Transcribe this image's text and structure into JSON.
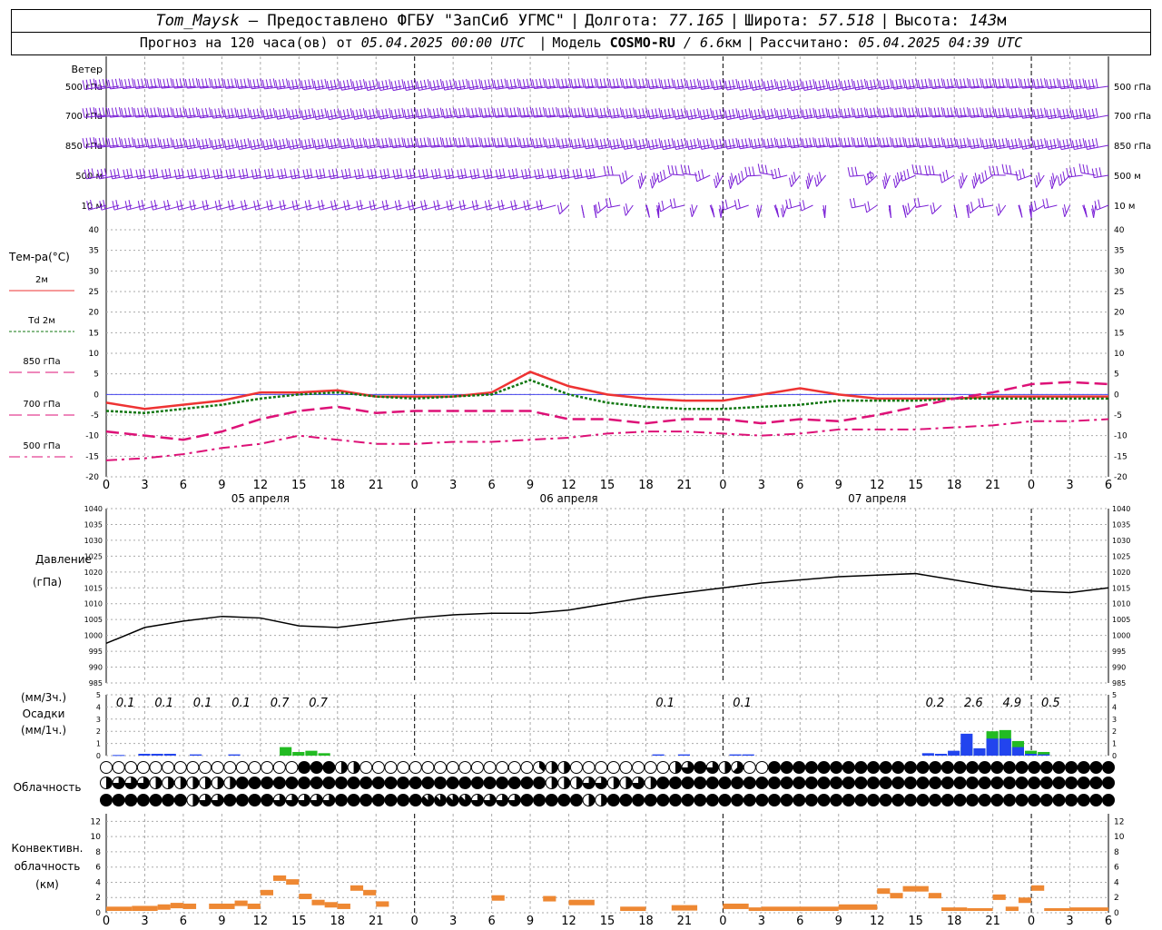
{
  "header": {
    "station": "Tom_Maysk",
    "dash": "–",
    "provider": "Предоставлено ФГБУ \"ЗапСиб УГМС\"",
    "lon_label": "Долгота:",
    "lon_value": "77.165",
    "lat_label": "Широта:",
    "lat_value": "57.518",
    "alt_label": "Высота:",
    "alt_value": "143",
    "alt_unit": "м",
    "forecast_prefix": "Прогноз на 120 часа(ов) от",
    "forecast_date": "05.04.2025 00:00 UTC",
    "model_label": "Модель",
    "model_name": "COSMO-RU",
    "model_res": "/ 6.6",
    "model_res_unit": "км",
    "computed_label": "Рассчитано:",
    "computed_date": "05.04.2025 04:39 UTC"
  },
  "colors": {
    "wind": "#7a1fd6",
    "t2m": "#ee3333",
    "td2m": "#117711",
    "levels": "#dd1177",
    "pressure": "#000000",
    "precip3h": "#22bb22",
    "precip1h": "#2244ee",
    "convective": "#ee8833",
    "grid": "#aaaaaa"
  },
  "labels": {
    "wind_title": "Ветер",
    "wind_levels": [
      "500 гПа",
      "700 гПа",
      "850 гПа",
      "500 м",
      "10 м"
    ],
    "temp_title": "Тем-ра(°С)",
    "temp_legend": [
      "2м",
      "Td  2м",
      "850 гПа",
      "700 гПа",
      "500 гПа"
    ],
    "pressure_title": "Давление",
    "pressure_unit": "(гПа)",
    "precip_title_1": "(мм/3ч.)",
    "precip_title_2": "Осадки",
    "precip_title_3": "(мм/1ч.)",
    "cloud_title": "Облачность",
    "conv_title_1": "Конвективн.",
    "conv_title_2": "облачность",
    "conv_title_3": "(км)"
  },
  "chart_data": [
    {
      "type": "wind_barbs",
      "levels": [
        "500 гПа",
        "700 гПа",
        "850 гПа",
        "500 м",
        "10 м"
      ]
    },
    {
      "type": "line",
      "title": "Тем-ра(°С)",
      "ylim": [
        -20,
        40
      ],
      "yticks": [
        -20,
        -15,
        -10,
        -5,
        0,
        5,
        10,
        15,
        20,
        25,
        30,
        35,
        40
      ],
      "x_hours": [
        0,
        3,
        6,
        9,
        12,
        15,
        18,
        21,
        24,
        27,
        30,
        33,
        36,
        39,
        42,
        45,
        48,
        51,
        54,
        57,
        60,
        63,
        66,
        69,
        72,
        75,
        78
      ],
      "series": [
        {
          "name": "2м",
          "style": "solid",
          "values": [
            -2,
            -3.5,
            -2.5,
            -1.5,
            0.5,
            0.5,
            1,
            -0.5,
            -0.5,
            -0.5,
            0.5,
            5.5,
            2,
            0,
            -1,
            -1.5,
            -1.5,
            0,
            1.5,
            0,
            -1,
            -1,
            -1,
            -0.5,
            -0.5,
            -0.5,
            -0.5
          ]
        },
        {
          "name": "Td  2м",
          "style": "dotted",
          "values": [
            -4,
            -4.5,
            -3.5,
            -2.5,
            -1,
            0,
            0.5,
            -0.5,
            -1,
            -0.5,
            0,
            3.5,
            0,
            -2,
            -3,
            -3.5,
            -3.5,
            -3,
            -2.5,
            -1.5,
            -1.5,
            -1.5,
            -1,
            -1,
            -1,
            -1,
            -1
          ]
        },
        {
          "name": "850 гПа",
          "style": "dashed",
          "values": [
            -9,
            -10,
            -11,
            -9,
            -6,
            -4,
            -3,
            -4.5,
            -4,
            -4,
            -4,
            -4,
            -6,
            -6,
            -7,
            -6,
            -6,
            -7,
            -6,
            -6.5,
            -5,
            -3,
            -1,
            0.5,
            2.5,
            3,
            2.5
          ]
        },
        {
          "name": "700 гПа",
          "style": "dashdot",
          "values": [
            -16,
            -15.5,
            -14.5,
            -13,
            -12,
            -10,
            -11,
            -12,
            -12,
            -11.5,
            -11.5,
            -11,
            -10.5,
            -9.5,
            -9,
            -9,
            -9.5,
            -10,
            -9.5,
            -8.5,
            -8.5,
            -8.5,
            -8,
            -7.5,
            -6.5,
            -6.5,
            -6
          ]
        }
      ]
    },
    {
      "type": "line",
      "title": "Давление",
      "ylabel": "(гПа)",
      "ylim": [
        985,
        1040
      ],
      "yticks": [
        985,
        990,
        995,
        1000,
        1005,
        1010,
        1015,
        1020,
        1025,
        1030,
        1035,
        1040
      ],
      "x_hours": [
        0,
        3,
        6,
        9,
        12,
        15,
        18,
        21,
        24,
        27,
        30,
        33,
        36,
        39,
        42,
        45,
        48,
        51,
        54,
        57,
        60,
        63,
        66,
        69,
        72,
        75,
        78
      ],
      "series": [
        {
          "name": "",
          "values": [
            997.5,
            1002.5,
            1004.5,
            1006,
            1005.5,
            1003,
            1002.5,
            1004,
            1005.5,
            1006.5,
            1007,
            1007,
            1008,
            1010,
            1012,
            1013.5,
            1015,
            1016.5,
            1017.5,
            1018.5,
            1019,
            1019.5,
            1017.5,
            1015.5,
            1014,
            1013.5,
            1015
          ]
        }
      ]
    },
    {
      "type": "bar",
      "title": "Осадки",
      "ylim": [
        0,
        5
      ],
      "yticks": [
        0,
        1,
        2,
        3,
        4,
        5
      ],
      "annotations_3h": [
        {
          "hour": 1.5,
          "text": "0.1"
        },
        {
          "hour": 4.5,
          "text": "0.1"
        },
        {
          "hour": 7.5,
          "text": "0.1"
        },
        {
          "hour": 10.5,
          "text": "0.1"
        },
        {
          "hour": 13.5,
          "text": "0.7"
        },
        {
          "hour": 16.5,
          "text": "0.7"
        },
        {
          "hour": 43.5,
          "text": "0.1"
        },
        {
          "hour": 49.5,
          "text": "0.1"
        },
        {
          "hour": 64.5,
          "text": "0.2"
        },
        {
          "hour": 67.5,
          "text": "2.6"
        },
        {
          "hour": 70.5,
          "text": "4.9"
        },
        {
          "hour": 73.5,
          "text": "0.5"
        }
      ],
      "bars_1h_green": [
        {
          "hour": 14,
          "value": 0.7
        },
        {
          "hour": 15,
          "value": 0.3
        },
        {
          "hour": 16,
          "value": 0.4
        },
        {
          "hour": 17,
          "value": 0.2
        },
        {
          "hour": 67,
          "value": 0.7
        },
        {
          "hour": 69,
          "value": 2.0
        },
        {
          "hour": 70,
          "value": 2.1
        },
        {
          "hour": 71,
          "value": 1.2
        },
        {
          "hour": 72,
          "value": 0.4
        },
        {
          "hour": 73,
          "value": 0.3
        }
      ],
      "bars_1h_blue": [
        {
          "hour": 1,
          "value": 0.05
        },
        {
          "hour": 3,
          "value": 0.15
        },
        {
          "hour": 4,
          "value": 0.15
        },
        {
          "hour": 5,
          "value": 0.15
        },
        {
          "hour": 7,
          "value": 0.1
        },
        {
          "hour": 10,
          "value": 0.1
        },
        {
          "hour": 43,
          "value": 0.1
        },
        {
          "hour": 45,
          "value": 0.1
        },
        {
          "hour": 49,
          "value": 0.1
        },
        {
          "hour": 50,
          "value": 0.1
        },
        {
          "hour": 64,
          "value": 0.2
        },
        {
          "hour": 65,
          "value": 0.15
        },
        {
          "hour": 66,
          "value": 0.4
        },
        {
          "hour": 67,
          "value": 1.8
        },
        {
          "hour": 68,
          "value": 0.6
        },
        {
          "hour": 69,
          "value": 1.4
        },
        {
          "hour": 70,
          "value": 1.4
        },
        {
          "hour": 71,
          "value": 0.7
        },
        {
          "hour": 72,
          "value": 0.15
        },
        {
          "hour": 73,
          "value": 0.1
        }
      ]
    },
    {
      "type": "cloud_cover",
      "title": "Облачность",
      "rows": [
        "0000000000000000888440000000000000034400000000468645008888888888888888888888888888",
        "4666444444488888888888888888888888884446644648888888888888888888888888888888888888",
        "8888888466888866666888888877776666888884488888888888888888888888888888888888888888"
      ]
    },
    {
      "type": "bar",
      "title": "Конвективн. облачность (км)",
      "ylim": [
        0,
        13
      ],
      "yticks": [
        0,
        2,
        4,
        6,
        8,
        10,
        12
      ],
      "segments": [
        {
          "start": 0,
          "end": 2,
          "value": 0.8
        },
        {
          "start": 2,
          "end": 4,
          "value": 0.9
        },
        {
          "start": 4,
          "end": 5,
          "value": 1.1
        },
        {
          "start": 5,
          "end": 6,
          "value": 1.3
        },
        {
          "start": 6,
          "end": 7,
          "value": 1.2
        },
        {
          "start": 8,
          "end": 10,
          "value": 1.2
        },
        {
          "start": 10,
          "end": 11,
          "value": 1.6
        },
        {
          "start": 11,
          "end": 12,
          "value": 1.2
        },
        {
          "start": 12,
          "end": 13,
          "value": 3.0
        },
        {
          "start": 13,
          "end": 14,
          "value": 4.9
        },
        {
          "start": 14,
          "end": 15,
          "value": 4.4
        },
        {
          "start": 15,
          "end": 16,
          "value": 2.5
        },
        {
          "start": 16,
          "end": 17,
          "value": 1.7
        },
        {
          "start": 17,
          "end": 18,
          "value": 1.4
        },
        {
          "start": 18,
          "end": 19,
          "value": 1.2
        },
        {
          "start": 19,
          "end": 20,
          "value": 3.6
        },
        {
          "start": 20,
          "end": 21,
          "value": 3.0
        },
        {
          "start": 21,
          "end": 22,
          "value": 1.5
        },
        {
          "start": 30,
          "end": 31,
          "value": 2.3
        },
        {
          "start": 34,
          "end": 35,
          "value": 2.2
        },
        {
          "start": 36,
          "end": 38,
          "value": 1.7
        },
        {
          "start": 40,
          "end": 42,
          "value": 0.8
        },
        {
          "start": 44,
          "end": 46,
          "value": 1.0
        },
        {
          "start": 48,
          "end": 50,
          "value": 1.2
        },
        {
          "start": 50,
          "end": 51,
          "value": 0.7
        },
        {
          "start": 51,
          "end": 57,
          "value": 0.8
        },
        {
          "start": 57,
          "end": 60,
          "value": 1.1
        },
        {
          "start": 60,
          "end": 61,
          "value": 3.2
        },
        {
          "start": 61,
          "end": 62,
          "value": 2.6
        },
        {
          "start": 62,
          "end": 64,
          "value": 3.5
        },
        {
          "start": 64,
          "end": 65,
          "value": 2.6
        },
        {
          "start": 65,
          "end": 67,
          "value": 0.7
        },
        {
          "start": 67,
          "end": 69,
          "value": 0.6
        },
        {
          "start": 69,
          "end": 70,
          "value": 2.4
        },
        {
          "start": 70,
          "end": 71,
          "value": 0.8
        },
        {
          "start": 71,
          "end": 72,
          "value": 2.0
        },
        {
          "start": 72,
          "end": 73,
          "value": 3.6
        },
        {
          "start": 73,
          "end": 75,
          "value": 0.6
        },
        {
          "start": 75,
          "end": 78,
          "value": 0.7
        }
      ]
    }
  ],
  "x_axis": {
    "tick_labels": [
      "0",
      "3",
      "6",
      "9",
      "12",
      "15",
      "18",
      "21",
      "0",
      "3",
      "6",
      "9",
      "12",
      "15",
      "18",
      "21",
      "0",
      "3",
      "6",
      "9",
      "12",
      "15",
      "18",
      "21",
      "0",
      "3",
      "6"
    ],
    "day_labels": [
      "05 апреля",
      "06 апреля",
      "07 апреля"
    ]
  }
}
